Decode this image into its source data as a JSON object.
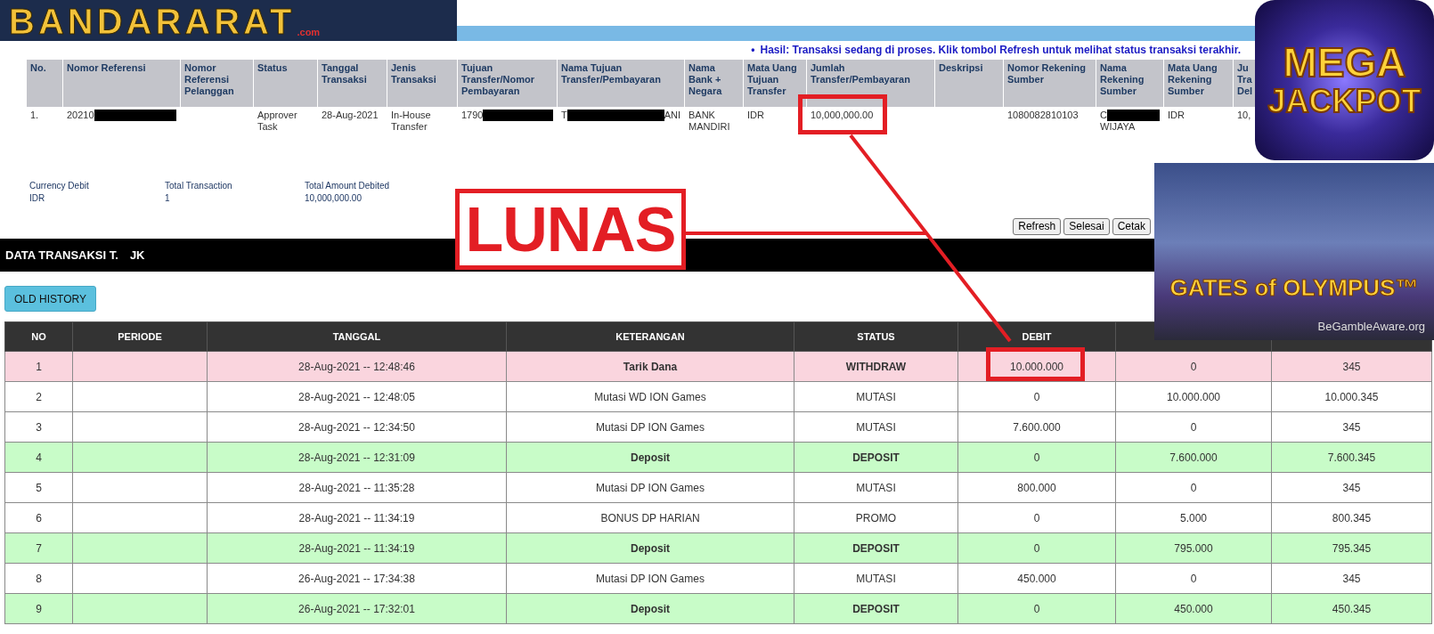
{
  "logo": {
    "name": "BANDARARAT",
    "suffix": ".com"
  },
  "notice": {
    "bullet": "•",
    "text": "Hasil: Transaksi sedang di proses. Klik tombol Refresh untuk melihat status transaksi terakhir."
  },
  "transfer_table": {
    "columns": [
      "No.",
      "Nomor Referensi",
      "Nomor Referensi Pelanggan",
      "Status",
      "Tanggal Transaksi",
      "Jenis Transaksi",
      "Tujuan Transfer/Nomor Pembayaran",
      "Nama Tujuan Transfer/Pembayaran",
      "Nama Bank + Negara",
      "Mata Uang Tujuan Transfer",
      "Jumlah Transfer/Pembayaran",
      "Deskripsi",
      "Nomor Rekening Sumber",
      "Nama Rekening Sumber",
      "Mata Uang Rekening Sumber",
      "Ju Tra Del"
    ],
    "rows": [
      {
        "cells": [
          {
            "text": "1."
          },
          {
            "text": "20210",
            "redacted": true
          },
          {
            "text": ""
          },
          {
            "text": "Approver Task"
          },
          {
            "text": "28-Aug-2021"
          },
          {
            "text": "In-House Transfer"
          },
          {
            "text": "1790",
            "redacted": true
          },
          {
            "text": "T",
            "redacted": true,
            "text_after": "ANI"
          },
          {
            "text": "BANK MANDIRI"
          },
          {
            "text": "IDR"
          },
          {
            "text": "10,000,000.00",
            "highlighted": true
          },
          {
            "text": ""
          },
          {
            "text": "1080082810103"
          },
          {
            "text": "C",
            "redacted": true,
            "text_below": "WIJAYA"
          },
          {
            "text": "IDR"
          },
          {
            "text": "10,"
          }
        ]
      }
    ]
  },
  "summary": [
    {
      "label": "Currency Debit",
      "value": "IDR"
    },
    {
      "label": "Total Transaction",
      "value": "1"
    },
    {
      "label": "Total Amount Debited",
      "value": "10,000,000.00"
    }
  ],
  "buttons": [
    "Refresh",
    "Selesai",
    "Cetak"
  ],
  "section_title": {
    "text": "DATA TRANSAKSI T.",
    "text_after": "JK"
  },
  "old_history_button": "OLD HISTORY",
  "history_table": {
    "columns": [
      "NO",
      "PERIODE",
      "TANGGAL",
      "KETERANGAN",
      "STATUS",
      "DEBIT"
    ],
    "rows": [
      {
        "kind": "withdraw",
        "cells": [
          "1",
          "",
          "28-Aug-2021 -- 12:48:46",
          "Tarik Dana",
          "WITHDRAW",
          "10.000.000",
          "0",
          "345"
        ],
        "debit_highlighted": true
      },
      {
        "kind": "mutasi",
        "cells": [
          "2",
          "",
          "28-Aug-2021 -- 12:48:05",
          "Mutasi WD ION Games",
          "MUTASI",
          "0",
          "10.000.000",
          "10.000.345"
        ]
      },
      {
        "kind": "mutasi",
        "cells": [
          "3",
          "",
          "28-Aug-2021 -- 12:34:50",
          "Mutasi DP ION Games",
          "MUTASI",
          "7.600.000",
          "0",
          "345"
        ]
      },
      {
        "kind": "deposit",
        "cells": [
          "4",
          "",
          "28-Aug-2021 -- 12:31:09",
          "Deposit",
          "DEPOSIT",
          "0",
          "7.600.000",
          "7.600.345"
        ]
      },
      {
        "kind": "mutasi",
        "cells": [
          "5",
          "",
          "28-Aug-2021 -- 11:35:28",
          "Mutasi DP ION Games",
          "MUTASI",
          "800.000",
          "0",
          "345"
        ]
      },
      {
        "kind": "promo",
        "cells": [
          "6",
          "",
          "28-Aug-2021 -- 11:34:19",
          "BONUS DP HARIAN",
          "PROMO",
          "0",
          "5.000",
          "800.345"
        ]
      },
      {
        "kind": "deposit",
        "cells": [
          "7",
          "",
          "28-Aug-2021 -- 11:34:19",
          "Deposit",
          "DEPOSIT",
          "0",
          "795.000",
          "795.345"
        ]
      },
      {
        "kind": "mutasi",
        "cells": [
          "8",
          "",
          "26-Aug-2021 -- 17:34:38",
          "Mutasi DP ION Games",
          "MUTASI",
          "450.000",
          "0",
          "345"
        ]
      },
      {
        "kind": "deposit",
        "cells": [
          "9",
          "",
          "26-Aug-2021 -- 17:32:01",
          "Deposit",
          "DEPOSIT",
          "0",
          "450.000",
          "450.345"
        ]
      }
    ]
  },
  "stamp": "LUNAS",
  "jackpot_badge": {
    "line_1": "MEGA",
    "line_2": "JACKPOT"
  },
  "promo_banner": {
    "title": "GATES of OLYMPUS™",
    "footer": "BeGambleAware.org"
  }
}
